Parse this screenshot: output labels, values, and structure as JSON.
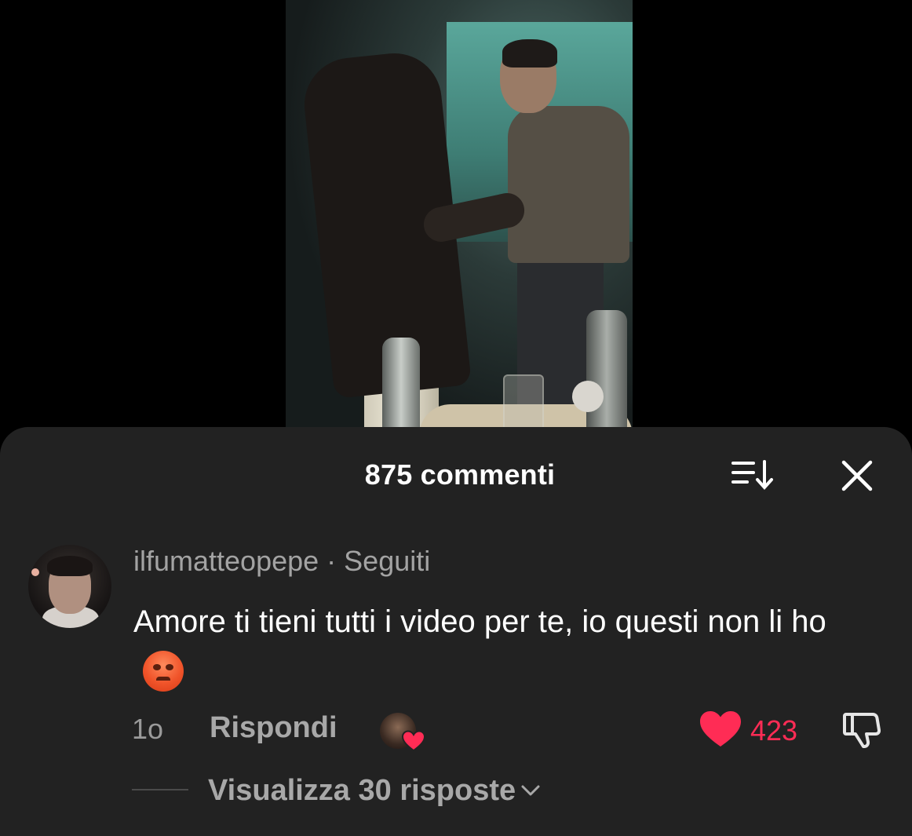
{
  "comments_panel": {
    "title": "875 commenti"
  },
  "comment": {
    "username": "ilfumatteopepe",
    "separator": " · ",
    "relation": "Seguiti",
    "text": "Amore ti tieni tutti i video per te, io questi non li ho",
    "emoji": "angry-face",
    "time": "1o",
    "reply_label": "Rispondi",
    "like_count": "423",
    "liked": true,
    "creator_liked": true,
    "view_replies_label": "Visualizza 30 risposte"
  },
  "colors": {
    "sheet_bg": "#222222",
    "like_red": "#ff2c55",
    "secondary_text": "#a3a3a3"
  }
}
